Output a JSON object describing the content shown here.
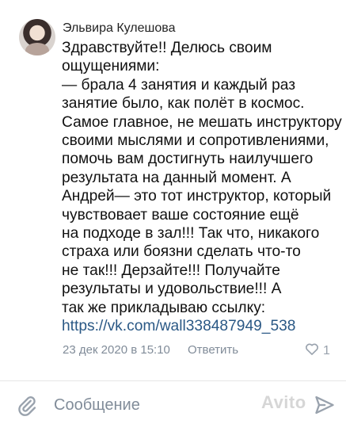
{
  "comment": {
    "author": "Эльвира Кулешова",
    "lines": [
      "Здравствуйте!! Делюсь своим",
      "ощущениями:",
      "— брала 4 занятия и каждый  раз",
      "занятие было, как полёт в космос.",
      "Самое главное, не мешать инструктору",
      "своими мыслями и сопротивлениями,",
      "помочь вам достигнуть наилучшего",
      "результата на данный момент. А",
      "Андрей— это тот инструктор, который",
      "чувствовает ваше состояние ещё",
      "на подходе в зал!!! Так что, никакого",
      "страха или боязни сделать что-то",
      "не так!!! Дерзайте!!! Получайте",
      "результаты и удовольствие!!! А",
      "так же прикладываю ссылку:"
    ],
    "link": "https://vk.com/wall338487949_538",
    "date": "23 дек 2020 в 15:10",
    "reply_label": "Ответить",
    "likes": "1"
  },
  "composer": {
    "placeholder": "Сообщение",
    "attach_icon": "paperclip-icon",
    "send_icon": "send-icon"
  },
  "watermark": "Avito",
  "colors": {
    "link": "#2a5885",
    "meta": "#818c99"
  }
}
